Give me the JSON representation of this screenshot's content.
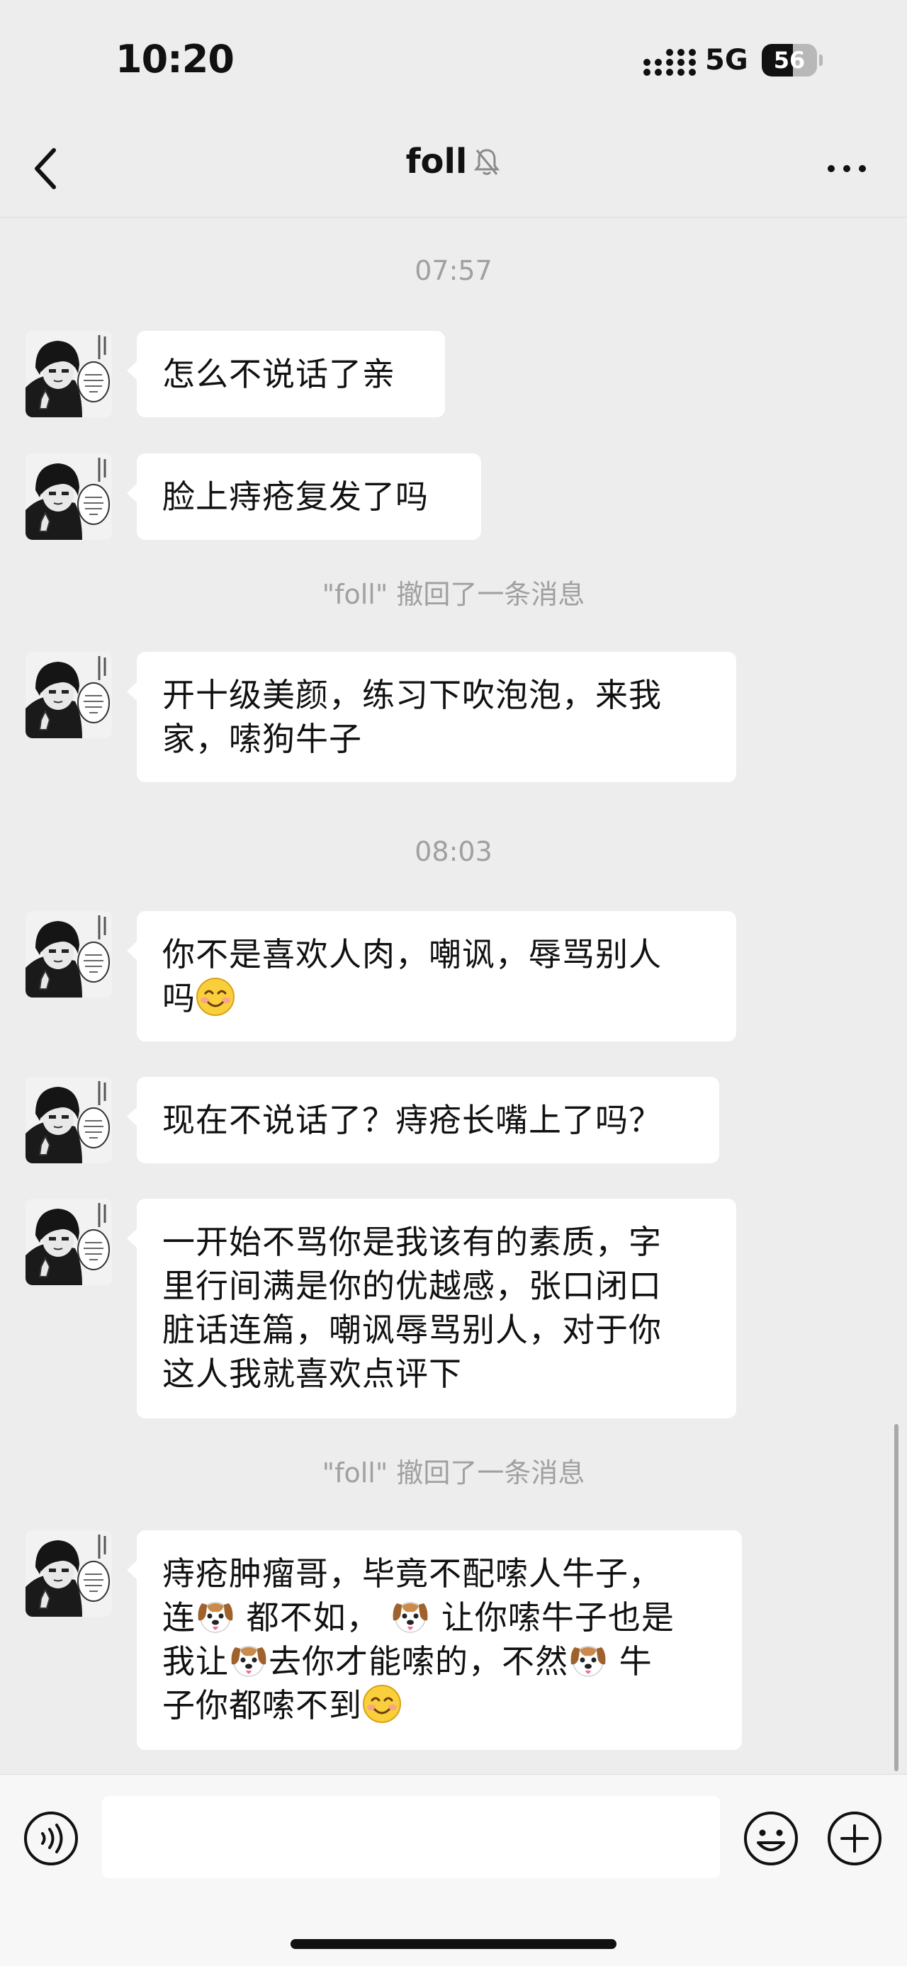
{
  "status_bar": {
    "time": "10:20",
    "network": "5G",
    "battery": "56",
    "battery_level_percent": 56
  },
  "nav": {
    "title": "foll",
    "back_icon": "chevron-left-icon",
    "mute_icon": "bell-slash-icon",
    "more_icon": "ellipsis-icon"
  },
  "messages": [
    {
      "type": "timestamp",
      "text": "07:57"
    },
    {
      "type": "message",
      "text": "怎么不说话了亲"
    },
    {
      "type": "message",
      "text": "脸上痔疮复发了吗"
    },
    {
      "type": "recall",
      "text": "\"foll\" 撤回了一条消息"
    },
    {
      "type": "message",
      "lines": [
        "开十级美颜，练习下吹泡泡，来我",
        "家，嗦狗牛子"
      ]
    },
    {
      "type": "timestamp",
      "text": "08:03"
    },
    {
      "type": "message",
      "lines": [
        "你不是喜欢人肉，嘲讽，辱骂别人",
        "吗"
      ],
      "emoji": "smiling-face-emoji"
    },
    {
      "type": "message",
      "text": "现在不说话了？痔疮长嘴上了吗？"
    },
    {
      "type": "message",
      "lines": [
        "一开始不骂你是我该有的素质，字",
        "里行间满是你的优越感，张口闭口",
        "脏话连篇，嘲讽辱骂别人，对于你",
        "这人我就喜欢点评下"
      ]
    },
    {
      "type": "recall",
      "text": "\"foll\" 撤回了一条消息"
    },
    {
      "type": "message",
      "segments": [
        "痔疮肿瘤哥，毕竟不配嗦人牛子，",
        "连",
        "都不如，",
        "让你嗦牛子也是",
        "我让",
        "去你才能嗦的，不然",
        "牛",
        "子你都嗦不到"
      ],
      "emoji": "dog-face-emoji"
    }
  ],
  "input_bar": {
    "placeholder": "",
    "voice_icon": "voice-icon",
    "emoji_icon": "emoji-icon",
    "plus_icon": "plus-icon"
  },
  "colors": {
    "background": "#ededed",
    "bubble": "#ffffff",
    "notice_text": "#a0a0a0"
  }
}
